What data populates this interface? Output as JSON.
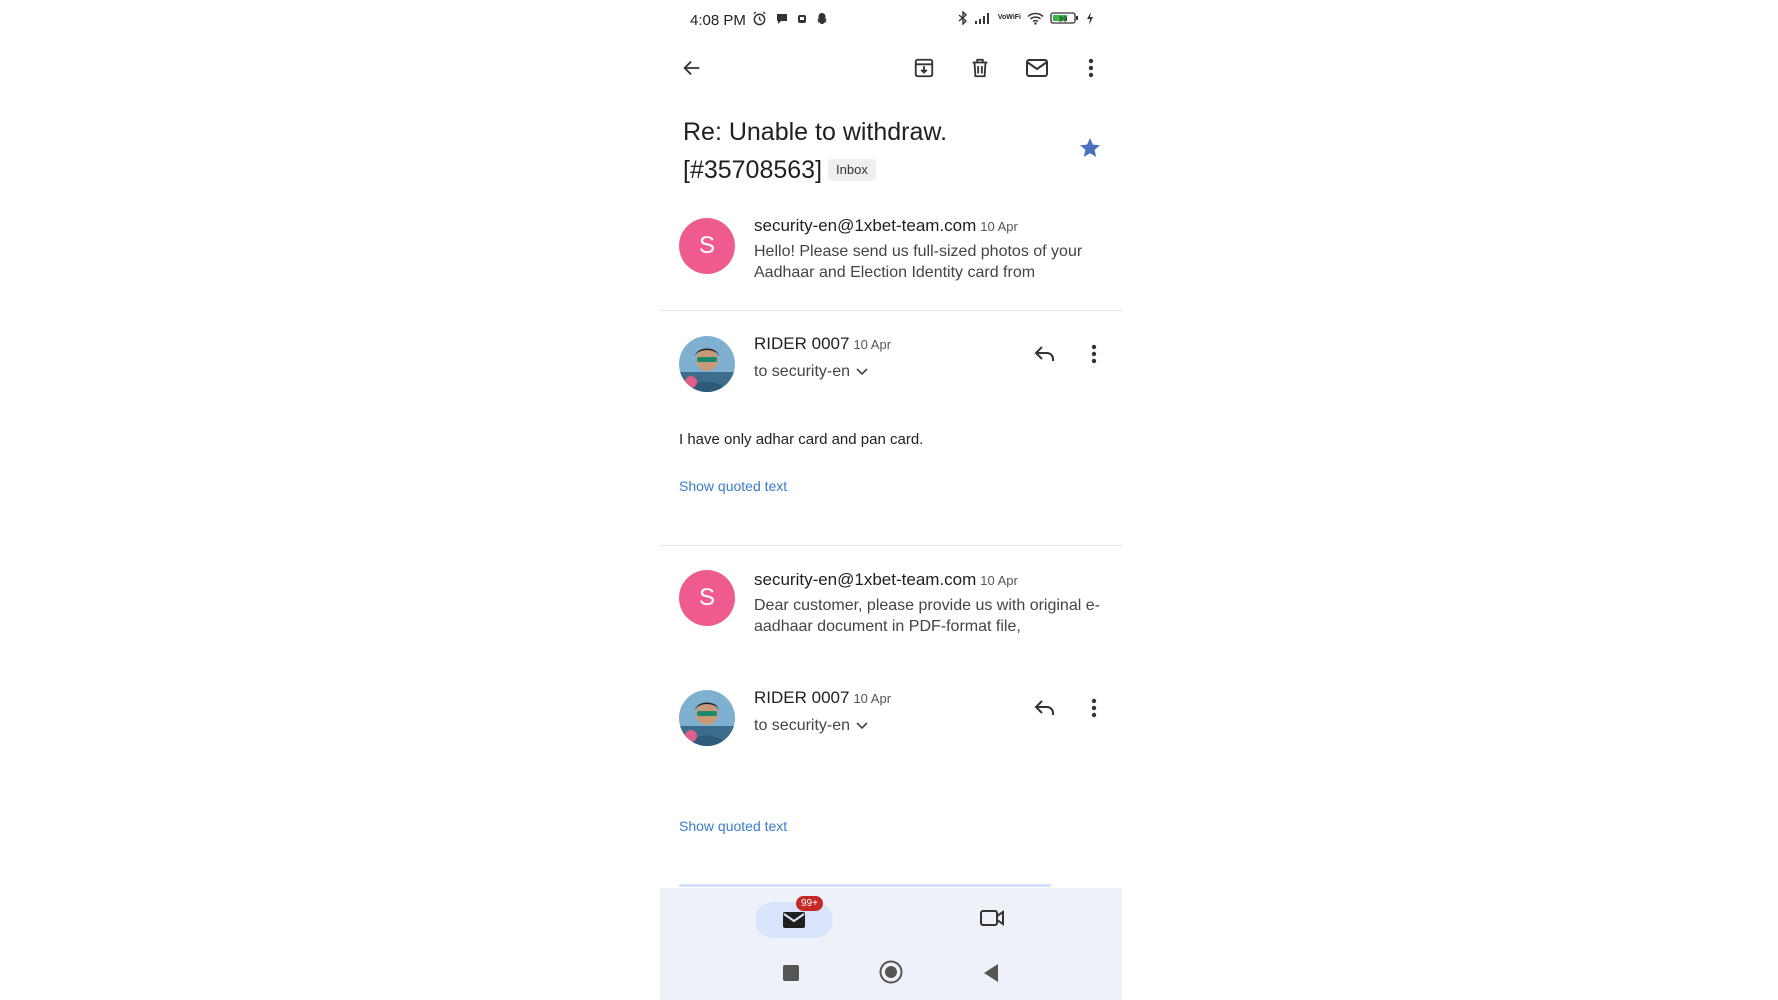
{
  "status_bar": {
    "time": "4:08 PM",
    "volte_top": "Vo",
    "volte_bottom": "WiFi",
    "battery_level": "39"
  },
  "toolbar": {
    "back_icon": "arrow-back-icon",
    "archive_icon": "archive-icon",
    "delete_icon": "delete-icon",
    "mark_unread_icon": "mail-icon",
    "more_icon": "more-vert-icon"
  },
  "thread": {
    "subject": "Re: Unable to withdraw. [#35708563]",
    "label": "Inbox",
    "starred": true
  },
  "messages": [
    {
      "avatar_letter": "S",
      "sender": "security-en@1xbet-team.com",
      "date": "10 Apr",
      "snippet": "Hello! Please send us full-sized photos of your Aadhaar and Election Identity card from"
    },
    {
      "sender": "RIDER 0007",
      "date": "10 Apr",
      "to": "to security-en",
      "body": "I have only adhar card and pan card.",
      "show_quoted": "Show quoted text"
    },
    {
      "avatar_letter": "S",
      "sender": "security-en@1xbet-team.com",
      "date": "10 Apr",
      "snippet": "Dear customer, please provide us with original e-aadhaar document in PDF-format file,"
    },
    {
      "sender": "RIDER 0007",
      "date": "10 Apr",
      "to": "to security-en",
      "show_quoted": "Show quoted text"
    }
  ],
  "bottom_nav": {
    "mail_badge": "99+"
  },
  "colors": {
    "avatar_pink": "#ef5b8f",
    "star_blue": "#4a6fbf",
    "link_blue": "#3a7bd5",
    "badge_red": "#c62828"
  }
}
